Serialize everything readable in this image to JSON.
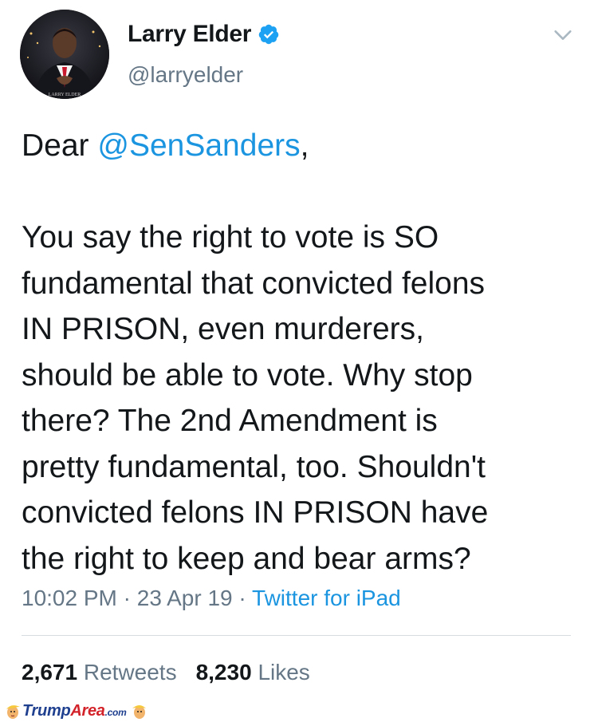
{
  "author": {
    "display_name": "Larry Elder",
    "handle": "@larryelder",
    "verified": true,
    "avatar_caption": "LARRY ELDER"
  },
  "tweet": {
    "lines": [
      {
        "parts": [
          {
            "text": "Dear ",
            "mention": false
          },
          {
            "text": "@SenSanders",
            "mention": true
          },
          {
            "text": ",",
            "mention": false
          }
        ]
      },
      {
        "parts": [
          {
            "text": "",
            "mention": false
          }
        ]
      },
      {
        "parts": [
          {
            "text": "You say the right to vote is SO",
            "mention": false
          }
        ]
      },
      {
        "parts": [
          {
            "text": "fundamental that convicted felons",
            "mention": false
          }
        ]
      },
      {
        "parts": [
          {
            "text": "IN PRISON, even murderers,",
            "mention": false
          }
        ]
      },
      {
        "parts": [
          {
            "text": "should be able to vote. Why stop",
            "mention": false
          }
        ]
      },
      {
        "parts": [
          {
            "text": "there? The 2nd Amendment is",
            "mention": false
          }
        ]
      },
      {
        "parts": [
          {
            "text": "pretty fundamental, too. Shouldn't",
            "mention": false
          }
        ]
      },
      {
        "parts": [
          {
            "text": "convicted felons IN PRISON have",
            "mention": false
          }
        ]
      },
      {
        "parts": [
          {
            "text": "the right to keep and bear arms?",
            "mention": false
          }
        ]
      }
    ]
  },
  "meta": {
    "time": "10:02 PM",
    "separator": " · ",
    "date": "23 Apr 19",
    "source": "Twitter for iPad"
  },
  "stats": {
    "retweets_count": "2,671",
    "retweets_label": "Retweets",
    "likes_count": "8,230",
    "likes_label": "Likes"
  },
  "watermark": {
    "brand_a": "Trump",
    "brand_b": "Area",
    "tld": ".com"
  },
  "colors": {
    "link": "#1b95e0",
    "secondary": "#657786",
    "primary_text": "#14171a",
    "verified": "#1da1f2"
  },
  "icons": {
    "verified": "verified-badge-icon",
    "menu": "chevron-down-icon"
  }
}
